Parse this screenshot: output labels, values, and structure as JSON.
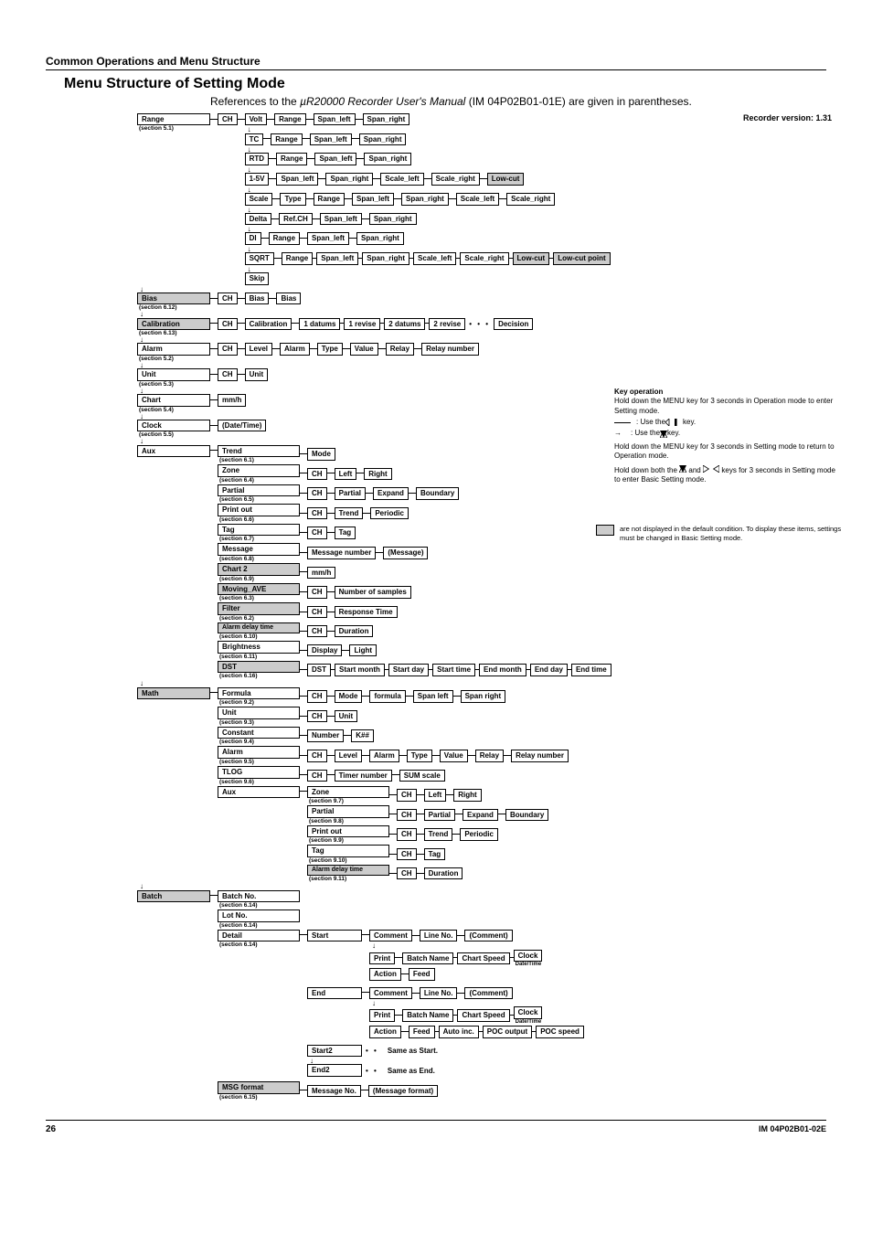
{
  "header": {
    "section": "Common Operations and Menu Structure",
    "title": "Menu Structure of Setting Mode"
  },
  "intro": {
    "pre": "References to the ",
    "ital": "µR20000 Recorder User's Manual",
    "post": " (IM 04P02B01-01E) are given in parentheses."
  },
  "version": "Recorder version: 1.31",
  "lvl1": {
    "range": "Range",
    "range_sec": "(section 5.1)",
    "bias": "Bias",
    "bias_sec": "(section 6.12)",
    "calibration": "Calibration",
    "calibration_sec": "(section 6.13)",
    "alarm": "Alarm",
    "alarm_sec": "(section 5.2)",
    "unit": "Unit",
    "unit_sec": "(section 5.3)",
    "chart": "Chart",
    "chart_sec": "(section 5.4)",
    "clock": "Clock",
    "clock_sec": "(section 5.5)",
    "aux": "Aux",
    "math": "Math",
    "batch": "Batch"
  },
  "range": {
    "ch": "CH",
    "items": {
      "volt": "Volt",
      "tc": "TC",
      "rtd": "RTD",
      "onefive": "1-5V",
      "scale": "Scale",
      "delta": "Delta",
      "di": "DI",
      "sqrt": "SQRT",
      "skip": "Skip"
    },
    "chains": {
      "std": [
        "Range",
        "Span_left",
        "Span_right"
      ],
      "onefive": [
        "Span_left",
        "Span_right",
        "Scale_left",
        "Scale_right",
        "Low-cut"
      ],
      "scale": [
        "Type",
        "Range",
        "Span_left",
        "Span_right",
        "Scale_left",
        "Scale_right"
      ],
      "delta": [
        "Ref.CH",
        "Span_left",
        "Span_right"
      ],
      "sqrt": [
        "Range",
        "Span_left",
        "Span_right",
        "Scale_left",
        "Scale_right",
        "Low-cut",
        "Low-cut point"
      ]
    }
  },
  "bias": {
    "ch": "CH",
    "a": "Bias",
    "b": "Bias"
  },
  "calibration": {
    "ch": "CH",
    "a": "Calibration",
    "chain": [
      "1 datums",
      "1 revise",
      "2 datums",
      "2 revise"
    ],
    "decision": "Decision"
  },
  "alarm": {
    "ch": "CH",
    "chain": [
      "Level",
      "Alarm",
      "Type",
      "Value",
      "Relay",
      "Relay number"
    ]
  },
  "unit": {
    "ch": "CH",
    "a": "Unit"
  },
  "chart": {
    "a": "mm/h"
  },
  "clock": {
    "a": "(Date/Time)"
  },
  "aux": {
    "trend": {
      "l": "Trend",
      "s": "(section 6.1)",
      "c": [
        "Mode"
      ]
    },
    "zone": {
      "l": "Zone",
      "s": "(section 6.4)",
      "c": [
        "CH",
        "Left",
        "Right"
      ]
    },
    "partial": {
      "l": "Partial",
      "s": "(section 6.5)",
      "c": [
        "CH",
        "Partial",
        "Expand",
        "Boundary"
      ]
    },
    "printout": {
      "l": "Print out",
      "s": "(section 6.6)",
      "c": [
        "CH",
        "Trend",
        "Periodic"
      ]
    },
    "tag": {
      "l": "Tag",
      "s": "(section 6.7)",
      "c": [
        "CH",
        "Tag"
      ]
    },
    "message": {
      "l": "Message",
      "s": "(section 6.8)",
      "c": [
        "Message number",
        "(Message)"
      ]
    },
    "chart2": {
      "l": "Chart 2",
      "s": "(section 6.9)",
      "c": [
        "mm/h"
      ]
    },
    "moving": {
      "l": "Moving_AVE",
      "s": "(section 6.3)",
      "c": [
        "CH",
        "Number of samples"
      ]
    },
    "filter": {
      "l": "Filter",
      "s": "(section 6.2)",
      "c": [
        "CH",
        "Response Time"
      ]
    },
    "adt": {
      "l": "Alarm delay time",
      "s": "(section 6.10)",
      "c": [
        "CH",
        "Duration"
      ]
    },
    "brightness": {
      "l": "Brightness",
      "s": "(section 6.11)",
      "c": [
        "Display",
        "Light"
      ]
    },
    "dst": {
      "l": "DST",
      "s": "(section 6.16)",
      "c": [
        "DST",
        "Start month",
        "Start day",
        "Start time",
        "End month",
        "End day",
        "End time"
      ]
    }
  },
  "math": {
    "formula": {
      "l": "Formula",
      "s": "(section 9.2)",
      "c": [
        "CH",
        "Mode",
        "formula",
        "Span left",
        "Span right"
      ]
    },
    "unit": {
      "l": "Unit",
      "s": "(section 9.3)",
      "c": [
        "CH",
        "Unit"
      ]
    },
    "constant": {
      "l": "Constant",
      "s": "(section 9.4)",
      "c": [
        "Number",
        "K##"
      ]
    },
    "alarm": {
      "l": "Alarm",
      "s": "(section 9.5)",
      "c": [
        "CH",
        "Level",
        "Alarm",
        "Type",
        "Value",
        "Relay",
        "Relay number"
      ]
    },
    "tlog": {
      "l": "TLOG",
      "s": "(section 9.6)",
      "c": [
        "CH",
        "Timer number",
        "SUM scale"
      ]
    },
    "aux": {
      "l": "Aux",
      "sub": {
        "zone": {
          "l": "Zone",
          "s": "(section 9.7)",
          "c": [
            "CH",
            "Left",
            "Right"
          ]
        },
        "partial": {
          "l": "Partial",
          "s": "(section 9.8)",
          "c": [
            "CH",
            "Partial",
            "Expand",
            "Boundary"
          ]
        },
        "printout": {
          "l": "Print out",
          "s": "(section 9.9)",
          "c": [
            "CH",
            "Trend",
            "Periodic"
          ]
        },
        "tag": {
          "l": "Tag",
          "s": "(section 9.10)",
          "c": [
            "CH",
            "Tag"
          ]
        },
        "adt": {
          "l": "Alarm delay time",
          "s": "(section 9.11)",
          "c": [
            "CH",
            "Duration"
          ]
        }
      }
    }
  },
  "batch": {
    "batchno": {
      "l": "Batch No.",
      "s": "(section 6.14)"
    },
    "lotno": {
      "l": "Lot No.",
      "s": "(section 6.14)"
    },
    "detail": {
      "l": "Detail",
      "s": "(section 6.14)",
      "sub": {
        "start": "Start",
        "end": "End",
        "start2": "Start2",
        "end2": "End2",
        "comment": {
          "l": "Comment",
          "c": [
            "Line No.",
            "(Comment)"
          ]
        },
        "print": {
          "l": "Print",
          "c": [
            "Batch Name",
            "Chart Speed",
            "Clock"
          ],
          "dt": "Date/Time"
        },
        "action_start": {
          "l": "Action",
          "c": [
            "Feed"
          ]
        },
        "action_end": {
          "l": "Action",
          "c": [
            "Feed",
            "Auto inc.",
            "POC output",
            "POC speed"
          ]
        },
        "same_start": "Same as Start.",
        "same_end": "Same as End."
      }
    },
    "msgformat": {
      "l": "MSG format",
      "s": "(section 6.15)",
      "c": [
        "Message No.",
        "(Message format)"
      ]
    }
  },
  "key": {
    "title": "Key operation",
    "l1": "Hold down the MENU key for 3 seconds in Operation mode to enter Setting mode.",
    "l2a": ":  Use the ",
    "l2b": " key.",
    "l3a": ":  Use the ",
    "l3b": " key.",
    "l4": "Hold down the MENU key for 3 seconds in Setting mode to return to Operation mode.",
    "l5a": "Hold down both the ",
    "l5b": " and ",
    "l5c": " keys for 3 seconds in Setting mode to enter Basic Setting mode."
  },
  "note": "are not displayed in the default condition. To display these items, settings must be changed in Basic Setting mode.",
  "footer": {
    "page": "26",
    "doc": "IM 04P02B01-02E"
  }
}
